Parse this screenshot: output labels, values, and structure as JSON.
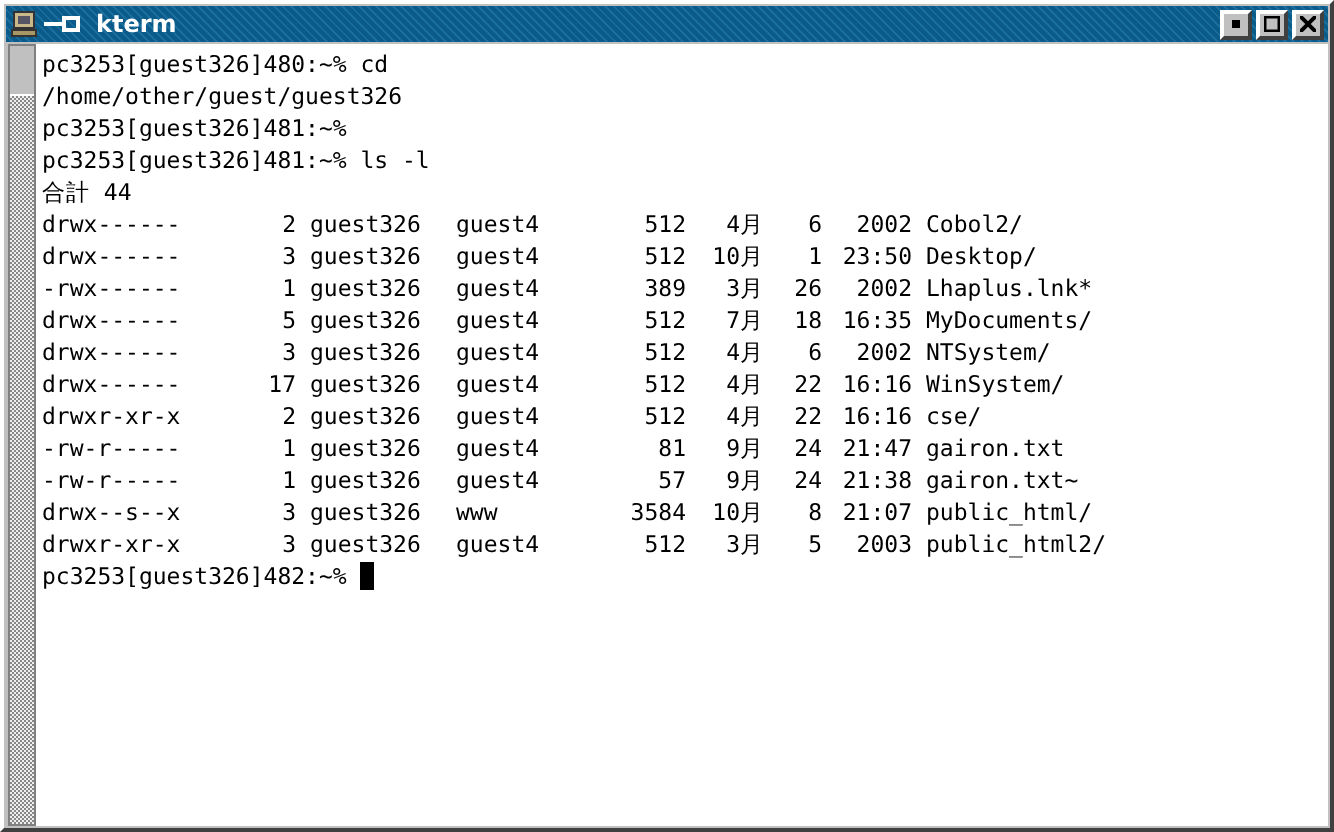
{
  "window": {
    "title": "kterm"
  },
  "terminal": {
    "lines_before": [
      "pc3253[guest326]480:~% cd",
      "/home/other/guest/guest326",
      "pc3253[guest326]481:~%",
      "pc3253[guest326]481:~% ls -l",
      "合計 44"
    ],
    "listing": [
      {
        "perms": "drwx------",
        "links": "2",
        "owner": "guest326",
        "group": "guest4",
        "size": "512",
        "month": "4月",
        "day": "6",
        "time": "2002",
        "name": "Cobol2/"
      },
      {
        "perms": "drwx------",
        "links": "3",
        "owner": "guest326",
        "group": "guest4",
        "size": "512",
        "month": "10月",
        "day": "1",
        "time": "23:50",
        "name": "Desktop/"
      },
      {
        "perms": "-rwx------",
        "links": "1",
        "owner": "guest326",
        "group": "guest4",
        "size": "389",
        "month": "3月",
        "day": "26",
        "time": "2002",
        "name": "Lhaplus.lnk*"
      },
      {
        "perms": "drwx------",
        "links": "5",
        "owner": "guest326",
        "group": "guest4",
        "size": "512",
        "month": "7月",
        "day": "18",
        "time": "16:35",
        "name": "MyDocuments/"
      },
      {
        "perms": "drwx------",
        "links": "3",
        "owner": "guest326",
        "group": "guest4",
        "size": "512",
        "month": "4月",
        "day": "6",
        "time": "2002",
        "name": "NTSystem/"
      },
      {
        "perms": "drwx------",
        "links": "17",
        "owner": "guest326",
        "group": "guest4",
        "size": "512",
        "month": "4月",
        "day": "22",
        "time": "16:16",
        "name": "WinSystem/"
      },
      {
        "perms": "drwxr-xr-x",
        "links": "2",
        "owner": "guest326",
        "group": "guest4",
        "size": "512",
        "month": "4月",
        "day": "22",
        "time": "16:16",
        "name": "cse/"
      },
      {
        "perms": "-rw-r-----",
        "links": "1",
        "owner": "guest326",
        "group": "guest4",
        "size": "81",
        "month": "9月",
        "day": "24",
        "time": "21:47",
        "name": "gairon.txt"
      },
      {
        "perms": "-rw-r-----",
        "links": "1",
        "owner": "guest326",
        "group": "guest4",
        "size": "57",
        "month": "9月",
        "day": "24",
        "time": "21:38",
        "name": "gairon.txt~"
      },
      {
        "perms": "drwx--s--x",
        "links": "3",
        "owner": "guest326",
        "group": "www",
        "size": "3584",
        "month": "10月",
        "day": "8",
        "time": "21:07",
        "name": "public_html/"
      },
      {
        "perms": "drwxr-xr-x",
        "links": "3",
        "owner": "guest326",
        "group": "guest4",
        "size": "512",
        "month": "3月",
        "day": "5",
        "time": "2003",
        "name": "public_html2/"
      }
    ],
    "prompt": "pc3253[guest326]482:~%"
  }
}
